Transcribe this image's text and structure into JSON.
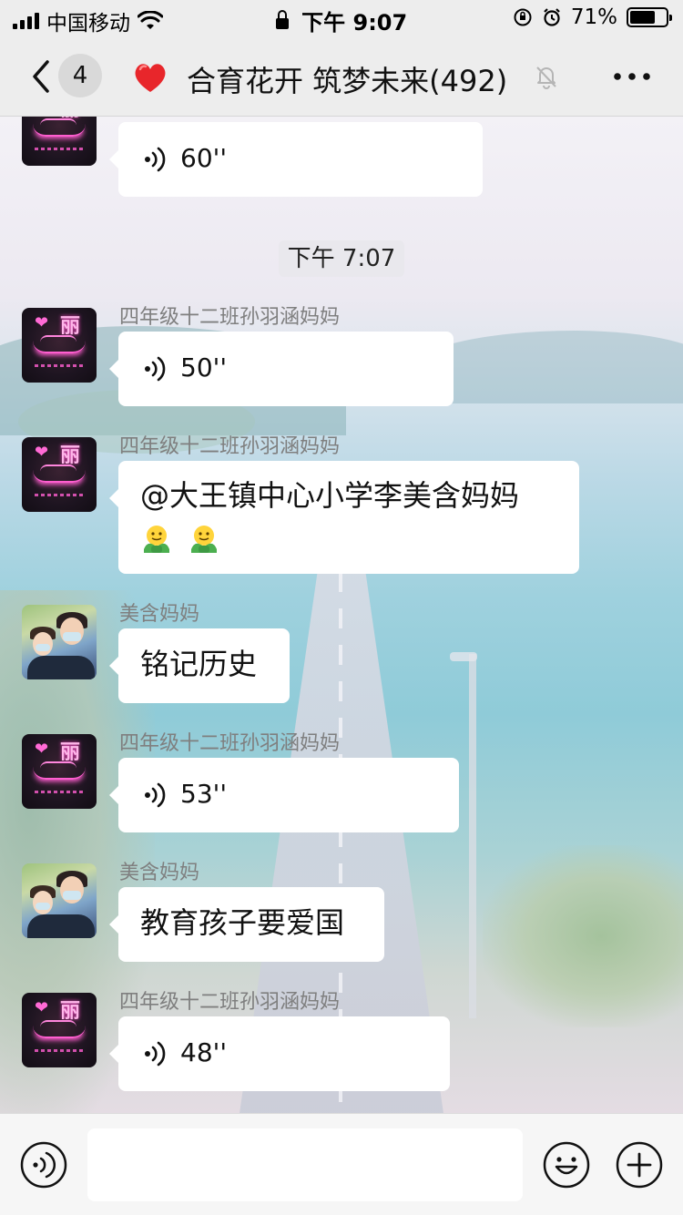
{
  "status_bar": {
    "carrier": "中国移动",
    "time": "下午 9:07",
    "battery": "71%",
    "battery_level": 0.71
  },
  "header": {
    "back_count": "4",
    "title": "合育花开 筑梦未来(492)",
    "title_icon": "heart-emoji",
    "muted": true
  },
  "messages": [
    {
      "type": "voice",
      "duration": "60''",
      "avatar": "pink-neon"
    },
    {
      "type": "time",
      "text": "下午 7:07"
    },
    {
      "type": "voice",
      "sender": "四年级十二班孙羽涵妈妈",
      "duration": "50''",
      "avatar": "pink-neon"
    },
    {
      "type": "text",
      "sender": "四年级十二班孙羽涵妈妈",
      "text": "@大王镇中心小学李美含妈妈",
      "emoji": "hug-emoji x2",
      "avatar": "pink-neon"
    },
    {
      "type": "text",
      "sender": "美含妈妈",
      "text": "铭记历史",
      "avatar": "photo"
    },
    {
      "type": "voice",
      "sender": "四年级十二班孙羽涵妈妈",
      "duration": "53''",
      "avatar": "pink-neon"
    },
    {
      "type": "text",
      "sender": "美含妈妈",
      "text": "教育孩子要爱国",
      "avatar": "photo"
    },
    {
      "type": "voice",
      "sender": "四年级十二班孙羽涵妈妈",
      "duration": "48''",
      "avatar": "pink-neon"
    }
  ],
  "colors": {
    "bubble": "#ffffff",
    "bar_bg": "#ededed",
    "heart": "#e8262b",
    "hug_emoji_green": "#4caf50",
    "hug_emoji_yellow": "#ffd43b"
  }
}
